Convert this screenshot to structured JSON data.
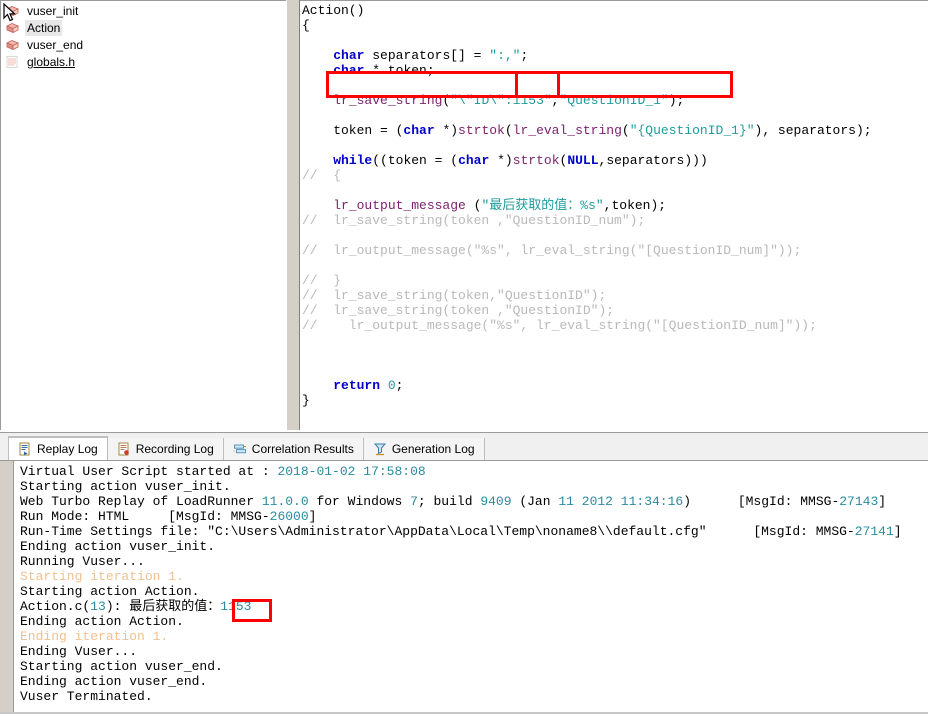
{
  "tree": {
    "items": [
      {
        "label": "vuser_init",
        "icon": "brick-icon",
        "selected": false,
        "link": false
      },
      {
        "label": "Action",
        "icon": "brick-icon",
        "selected": true,
        "link": false
      },
      {
        "label": "vuser_end",
        "icon": "brick-icon",
        "selected": false,
        "link": false
      },
      {
        "label": "globals.h",
        "icon": "header-file-icon",
        "selected": false,
        "link": true
      }
    ]
  },
  "editor": {
    "lines": [
      {
        "id": "l01",
        "text": "Action()"
      },
      {
        "id": "l02",
        "text": "{"
      },
      {
        "id": "l03",
        "text": ""
      },
      {
        "id": "l04",
        "text": "    char separators[] = \":,\";"
      },
      {
        "id": "l05",
        "text": "    char * token;"
      },
      {
        "id": "l06",
        "text": ""
      },
      {
        "id": "l07",
        "text": "    lr_save_string(\"\\\"ID\\\":1153\",\"QuestionID_1\");"
      },
      {
        "id": "l08",
        "text": ""
      },
      {
        "id": "l09",
        "text": "    token = (char *)strtok(lr_eval_string(\"{QuestionID_1}\"), separators);"
      },
      {
        "id": "l10",
        "text": ""
      },
      {
        "id": "l11",
        "text": "    while((token = (char *)strtok(NULL,separators)))"
      },
      {
        "id": "l12",
        "text": "//  {"
      },
      {
        "id": "l13",
        "text": ""
      },
      {
        "id": "l14",
        "text": "    lr_output_message (\"最后获取的值：%s\",token);"
      },
      {
        "id": "l15",
        "text": "//  lr_save_string(token ,\"QuestionID_num\");"
      },
      {
        "id": "l16",
        "text": ""
      },
      {
        "id": "l17",
        "text": "//  lr_output_message(\"%s\", lr_eval_string(\"[QuestionID_num]\"));"
      },
      {
        "id": "l18",
        "text": ""
      },
      {
        "id": "l19",
        "text": "//  }"
      },
      {
        "id": "l20",
        "text": "//  lr_save_string(token,\"QuestionID\");"
      },
      {
        "id": "l21",
        "text": "//  lr_save_string(token ,\"QuestionID\");"
      },
      {
        "id": "l22",
        "text": "//    lr_output_message(\"%s\", lr_eval_string(\"[QuestionID_num]\"));"
      },
      {
        "id": "l23",
        "text": ""
      },
      {
        "id": "l24",
        "text": ""
      },
      {
        "id": "l25",
        "text": ""
      },
      {
        "id": "l26",
        "text": "    return 0;"
      },
      {
        "id": "l27",
        "text": "}"
      }
    ],
    "highlighted_value": "1153",
    "annotation_color": "#ff0000"
  },
  "tabs": [
    {
      "label": "Replay Log",
      "icon": "replay-log-icon",
      "active": true
    },
    {
      "label": "Recording Log",
      "icon": "recording-log-icon",
      "active": false
    },
    {
      "label": "Correlation Results",
      "icon": "correlation-results-icon",
      "active": false
    },
    {
      "label": "Generation Log",
      "icon": "generation-log-icon",
      "active": false
    }
  ],
  "log": {
    "lines": [
      "Virtual User Script started at : 2018-01-02 17:58:08",
      "Starting action vuser_init.",
      "Web Turbo Replay of LoadRunner 11.0.0 for Windows 7; build 9409 (Jan 11 2012 11:34:16)      [MsgId: MMSG-27143]",
      "Run Mode: HTML     [MsgId: MMSG-26000]",
      "Run-Time Settings file: \"C:\\Users\\Administrator\\AppData\\Local\\Temp\\noname8\\\\default.cfg\"      [MsgId: MMSG-27141]",
      "Ending action vuser_init.",
      "Running Vuser...",
      "Starting iteration 1.",
      "Starting action Action.",
      "Action.c(13): 最后获取的值：1153",
      "Ending action Action.",
      "Ending iteration 1.",
      "Ending Vuser...",
      "Starting action vuser_end.",
      "Ending action vuser_end.",
      "Vuser Terminated."
    ],
    "highlighted_value": "1153",
    "annotation_color": "#ff0000"
  }
}
